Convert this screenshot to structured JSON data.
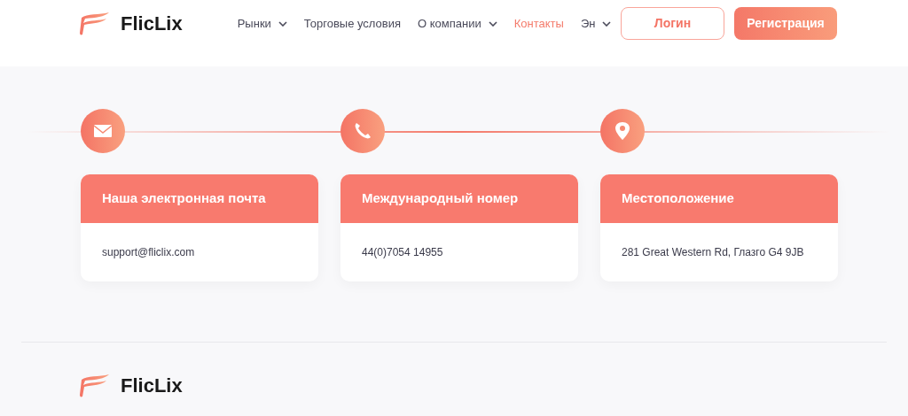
{
  "header": {
    "logo_text": "FlicLix",
    "nav": [
      {
        "label": "Рынки",
        "has_dropdown": true,
        "selected": false
      },
      {
        "label": "Торговые условия",
        "has_dropdown": false,
        "selected": false
      },
      {
        "label": "О компании",
        "has_dropdown": true,
        "selected": false
      },
      {
        "label": "Контакты",
        "has_dropdown": false,
        "selected": true
      },
      {
        "label": "Эн",
        "has_dropdown": true,
        "selected": false
      }
    ],
    "login_button": "Логин",
    "register_button": "Регистрация"
  },
  "contacts": [
    {
      "kind": "email",
      "title": "Наша электронная почта",
      "value": "support@fliclix.com"
    },
    {
      "kind": "phone",
      "title": "Международный номер",
      "value": "44(0)7054 14955"
    },
    {
      "kind": "location",
      "title": "Местоположение",
      "value": "281 Great Western Rd, Глазго G4 9JB"
    }
  ],
  "footer": {
    "logo_text": "FlicLix"
  }
}
